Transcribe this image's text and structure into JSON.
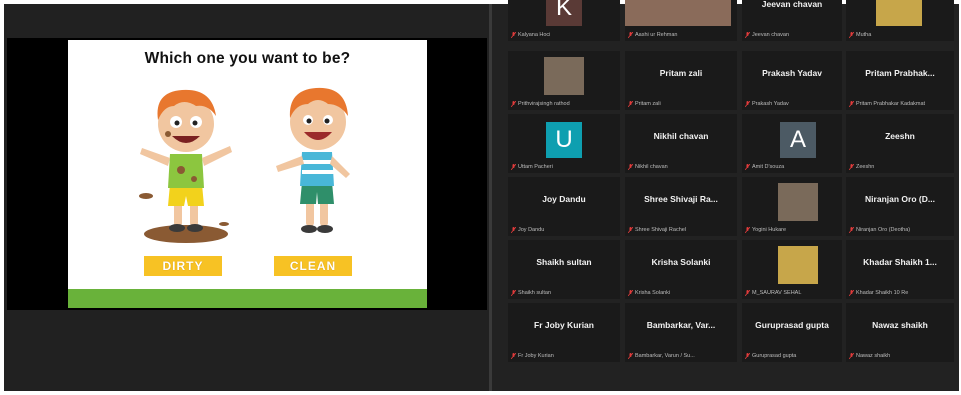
{
  "slide": {
    "title": "Which one you want to be?",
    "options": [
      "DIRTY",
      "CLEAN"
    ]
  },
  "colors": {
    "slide_button": "#f7c224",
    "grass": "#69b23a",
    "mic_muted": "#e23b3b",
    "avatar_teal": "#0e9fb0",
    "avatar_slate": "#4c5a64"
  },
  "participants": [
    {
      "name": "",
      "label": "Kalyana Hoci",
      "avatar": "K",
      "avatar_color": "#5a3a36",
      "video": false
    },
    {
      "name": "",
      "label": "Aashi ur Rehman",
      "avatar": "",
      "video": true
    },
    {
      "name": "Jeevan chavan",
      "label": "Jeevan chavan",
      "avatar": "",
      "video": false
    },
    {
      "name": "",
      "label": "Mutha",
      "avatar": "",
      "video": true
    },
    {
      "name": "",
      "label": "Prithvirajsingh rathod",
      "avatar": "",
      "video": true
    },
    {
      "name": "Pritam zali",
      "label": "Pritam zali",
      "avatar": "",
      "video": false
    },
    {
      "name": "Prakash Yadav",
      "label": "Prakash Yadav",
      "avatar": "",
      "video": false
    },
    {
      "name": "Pritam Prabhak...",
      "label": "Pritam Prabhakar Kadakmat",
      "avatar": "",
      "video": false
    },
    {
      "name": "",
      "label": "Uttam Pacheri",
      "avatar": "U",
      "avatar_color": "#0e9fb0",
      "video": false
    },
    {
      "name": "Nikhil chavan",
      "label": "Nikhil chavan",
      "avatar": "",
      "video": false
    },
    {
      "name": "",
      "label": "Amit D'souza",
      "avatar": "A",
      "avatar_color": "#4c5a64",
      "video": false
    },
    {
      "name": "Zeeshn",
      "label": "Zeeshn",
      "avatar": "",
      "video": false
    },
    {
      "name": "Joy Dandu",
      "label": "Joy Dandu",
      "avatar": "",
      "video": false
    },
    {
      "name": "Shree Shivaji Ra...",
      "label": "Shree Shivaji Rachel",
      "avatar": "",
      "video": false
    },
    {
      "name": "",
      "label": "Yogini Hukare",
      "avatar": "",
      "video": true
    },
    {
      "name": "Niranjan Oro (D...",
      "label": "Niranjan Oro (Deotha)",
      "avatar": "",
      "video": false
    },
    {
      "name": "Shaikh sultan",
      "label": "Shaikh sultan",
      "avatar": "",
      "video": false
    },
    {
      "name": "Krisha Solanki",
      "label": "Krisha Solanki",
      "avatar": "",
      "video": false
    },
    {
      "name": "",
      "label": "M_SAURAV SEHAL",
      "avatar": "",
      "video": true
    },
    {
      "name": "Khadar Shaikh 1...",
      "label": "Khadar Shaikh 10 Re",
      "avatar": "",
      "video": false
    },
    {
      "name": "Fr Joby Kurian",
      "label": "Fr Joby Kurian",
      "avatar": "",
      "video": false
    },
    {
      "name": "Bambarkar, Var...",
      "label": "Bambarkar, Varun / Su...",
      "avatar": "",
      "video": false
    },
    {
      "name": "Guruprasad gupta",
      "label": "Guruprasad gupta",
      "avatar": "",
      "video": false
    },
    {
      "name": "Nawaz shaikh",
      "label": "Nawaz shaikh",
      "avatar": "",
      "video": false
    }
  ]
}
